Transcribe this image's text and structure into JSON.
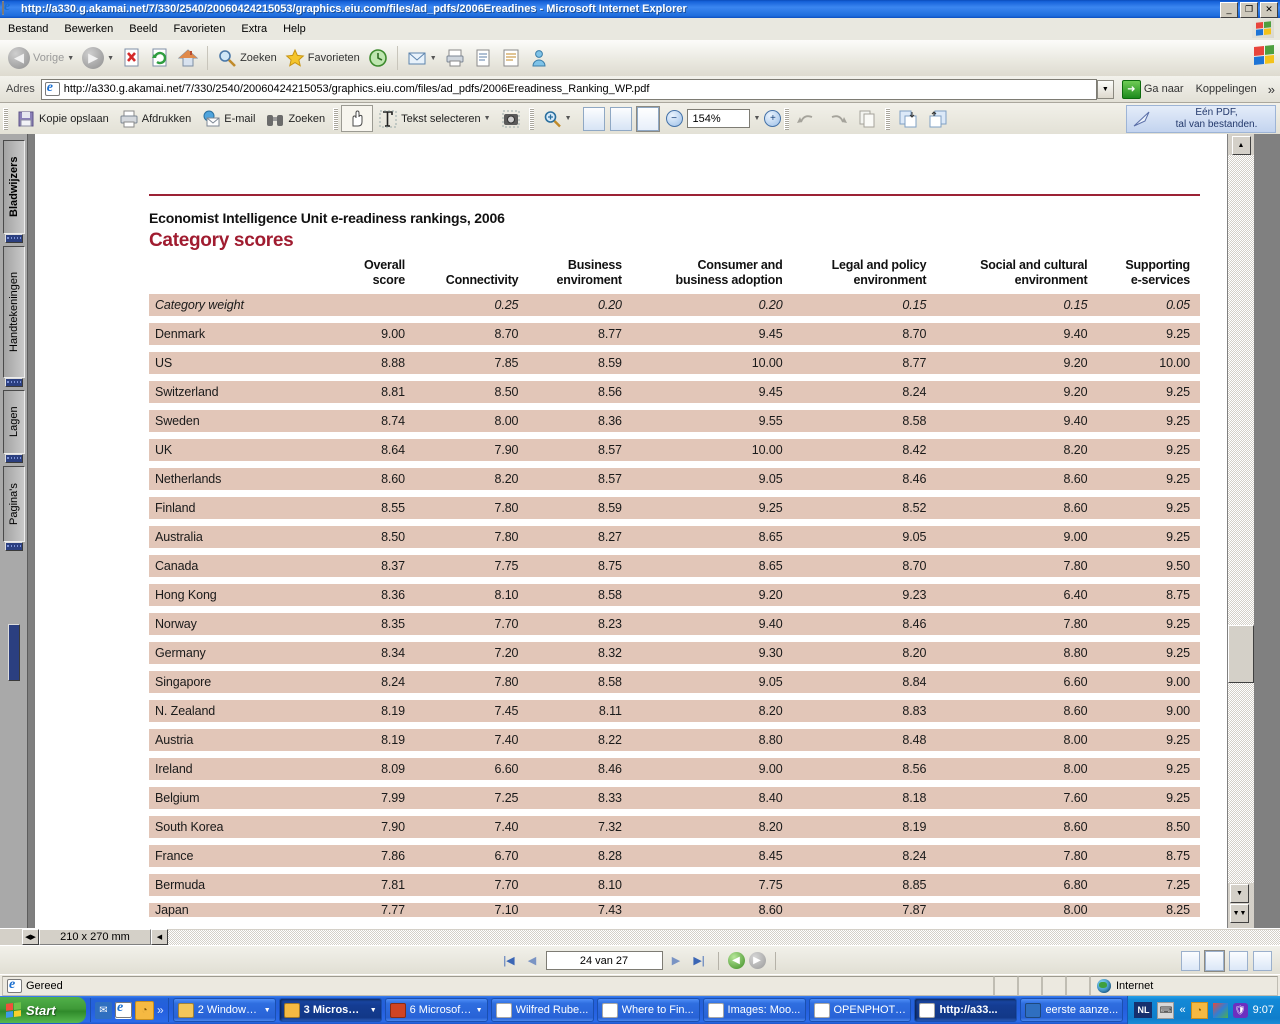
{
  "window": {
    "title": "http://a330.g.akamai.net/7/330/2540/20060424215053/graphics.eiu.com/files/ad_pdfs/2006Ereadines - Microsoft Internet Explorer",
    "minimize": "_",
    "restore": "❐",
    "close": "✕"
  },
  "menu": {
    "items": [
      "Bestand",
      "Bewerken",
      "Beeld",
      "Favorieten",
      "Extra",
      "Help"
    ]
  },
  "ie_toolbar": {
    "back": "Vorige",
    "forward": "",
    "stop": "stop-icon",
    "refresh": "refresh-icon",
    "home": "home-icon",
    "search": "Zoeken",
    "favorites": "Favorieten",
    "history": "history-icon",
    "mail": "mail-icon",
    "print": "print-icon",
    "edit": "edit-icon",
    "discuss": "discuss-icon",
    "messenger": "messenger-icon"
  },
  "address_bar": {
    "label": "Adres",
    "url": "http://a330.g.akamai.net/7/330/2540/20060424215053/graphics.eiu.com/files/ad_pdfs/2006Ereadiness_Ranking_WP.pdf",
    "go": "Ga naar",
    "links": "Koppelingen",
    "overflow": "»"
  },
  "pdf_toolbar": {
    "save_copy": "Kopie opslaan",
    "print": "Afdrukken",
    "email": "E-mail",
    "search": "Zoeken",
    "hand_tool": "hand-tool-icon",
    "select_text": "Tekst selecteren",
    "snapshot": "snapshot-icon",
    "zoom_tool": "zoom-tool-icon",
    "zoom_value": "154%",
    "zoom_out": "−",
    "zoom_in": "+",
    "undo": "undo-icon",
    "redo": "redo-icon",
    "copy": "copy-icon",
    "ad_line1": "Eén PDF,",
    "ad_line2": "tal van bestanden."
  },
  "nav_pane": {
    "tabs": [
      "Bladwijzers",
      "Handtekeningen",
      "Lagen",
      "Pagina's"
    ]
  },
  "page_nav": {
    "first": "|◀",
    "prev": "◀",
    "page_value": "24 van 27",
    "next": "▶",
    "last": "▶|",
    "prev_view": "◀",
    "next_view": "▶"
  },
  "doc_status": {
    "page_size": "210 x 270 mm"
  },
  "status_bar": {
    "text": "Gereed",
    "zone": "Internet"
  },
  "taskbar": {
    "start": "Start",
    "quick_launch": [
      "launch-ie-icon",
      "launch-browser-icon",
      "launch-acrobat-icon",
      "»"
    ],
    "tasks": [
      {
        "label": "2 Windows ...",
        "icon": "folder-icon",
        "active": false,
        "group": true
      },
      {
        "label": "3 Microsoft...",
        "icon": "window-icon",
        "active": true,
        "group": true
      },
      {
        "label": "6 Microsoft...",
        "icon": "powerpoint-icon",
        "active": false,
        "group": true
      },
      {
        "label": "Wilfred Rube...",
        "icon": "ie-icon",
        "active": false,
        "group": false
      },
      {
        "label": "Where to Fin...",
        "icon": "ie-icon",
        "active": false,
        "group": false
      },
      {
        "label": "Images: Moo...",
        "icon": "ie-icon",
        "active": false,
        "group": false
      },
      {
        "label": "OPENPHOTO...",
        "icon": "ie-icon",
        "active": false,
        "group": false
      },
      {
        "label": "http://a33...",
        "icon": "ie-icon",
        "active": true,
        "group": false
      },
      {
        "label": "eerste aanze...",
        "icon": "word-icon",
        "active": false,
        "group": false
      }
    ],
    "tray": {
      "language": "NL",
      "icons": [
        "keyboard-icon",
        "«",
        "clock-icon",
        "display-icon",
        "shield-icon"
      ],
      "clock": "9:07"
    }
  },
  "document": {
    "kicker": "Economist Intelligence Unit e-readiness rankings, 2006",
    "subtitle": "Category scores",
    "accent_color": "#a01c30",
    "row_color": "#e2c6b8",
    "columns": [
      "",
      "Overall\nscore",
      "Connectivity",
      "Business\nenviroment",
      "Consumer and\nbusiness adoption",
      "Legal and policy\nenvironment",
      "Social and cultural\nenvironment",
      "Supporting\ne-services"
    ],
    "columns_l1": [
      "",
      "Overall",
      "Connectivity",
      "Business",
      "Consumer and",
      "Legal and policy",
      "Social and cultural",
      "Supporting"
    ],
    "columns_l2": [
      "",
      "score",
      "",
      "enviroment",
      "business adoption",
      "environment",
      "environment",
      "e-services"
    ],
    "weight_label": "Category weight",
    "weights": [
      "",
      "0.25",
      "0.20",
      "0.20",
      "0.15",
      "0.15",
      "0.05"
    ],
    "rows": [
      {
        "country": "Denmark",
        "values": [
          "9.00",
          "8.70",
          "8.77",
          "9.45",
          "8.70",
          "9.40",
          "9.25"
        ]
      },
      {
        "country": "US",
        "values": [
          "8.88",
          "7.85",
          "8.59",
          "10.00",
          "8.77",
          "9.20",
          "10.00"
        ]
      },
      {
        "country": "Switzerland",
        "values": [
          "8.81",
          "8.50",
          "8.56",
          "9.45",
          "8.24",
          "9.20",
          "9.25"
        ]
      },
      {
        "country": "Sweden",
        "values": [
          "8.74",
          "8.00",
          "8.36",
          "9.55",
          "8.58",
          "9.40",
          "9.25"
        ]
      },
      {
        "country": "UK",
        "values": [
          "8.64",
          "7.90",
          "8.57",
          "10.00",
          "8.42",
          "8.20",
          "9.25"
        ]
      },
      {
        "country": "Netherlands",
        "values": [
          "8.60",
          "8.20",
          "8.57",
          "9.05",
          "8.46",
          "8.60",
          "9.25"
        ]
      },
      {
        "country": "Finland",
        "values": [
          "8.55",
          "7.80",
          "8.59",
          "9.25",
          "8.52",
          "8.60",
          "9.25"
        ]
      },
      {
        "country": "Australia",
        "values": [
          "8.50",
          "7.80",
          "8.27",
          "8.65",
          "9.05",
          "9.00",
          "9.25"
        ]
      },
      {
        "country": "Canada",
        "values": [
          "8.37",
          "7.75",
          "8.75",
          "8.65",
          "8.70",
          "7.80",
          "9.50"
        ]
      },
      {
        "country": "Hong Kong",
        "values": [
          "8.36",
          "8.10",
          "8.58",
          "9.20",
          "9.23",
          "6.40",
          "8.75"
        ]
      },
      {
        "country": "Norway",
        "values": [
          "8.35",
          "7.70",
          "8.23",
          "9.40",
          "8.46",
          "7.80",
          "9.25"
        ]
      },
      {
        "country": "Germany",
        "values": [
          "8.34",
          "7.20",
          "8.32",
          "9.30",
          "8.20",
          "8.80",
          "9.25"
        ]
      },
      {
        "country": "Singapore",
        "values": [
          "8.24",
          "7.80",
          "8.58",
          "9.05",
          "8.84",
          "6.60",
          "9.00"
        ]
      },
      {
        "country": "N. Zealand",
        "values": [
          "8.19",
          "7.45",
          "8.11",
          "8.20",
          "8.83",
          "8.60",
          "9.00"
        ]
      },
      {
        "country": "Austria",
        "values": [
          "8.19",
          "7.40",
          "8.22",
          "8.80",
          "8.48",
          "8.00",
          "9.25"
        ]
      },
      {
        "country": "Ireland",
        "values": [
          "8.09",
          "6.60",
          "8.46",
          "9.00",
          "8.56",
          "8.00",
          "9.25"
        ]
      },
      {
        "country": "Belgium",
        "values": [
          "7.99",
          "7.25",
          "8.33",
          "8.40",
          "8.18",
          "7.60",
          "9.25"
        ]
      },
      {
        "country": "South Korea",
        "values": [
          "7.90",
          "7.40",
          "7.32",
          "8.20",
          "8.19",
          "8.60",
          "8.50"
        ]
      },
      {
        "country": "France",
        "values": [
          "7.86",
          "6.70",
          "8.28",
          "8.45",
          "8.24",
          "7.80",
          "8.75"
        ]
      },
      {
        "country": "Bermuda",
        "values": [
          "7.81",
          "7.70",
          "8.10",
          "7.75",
          "8.85",
          "6.80",
          "7.25"
        ]
      },
      {
        "country": "Japan",
        "values": [
          "7.77",
          "7.10",
          "7.43",
          "8.60",
          "7.87",
          "8.00",
          "8.25"
        ]
      }
    ]
  }
}
